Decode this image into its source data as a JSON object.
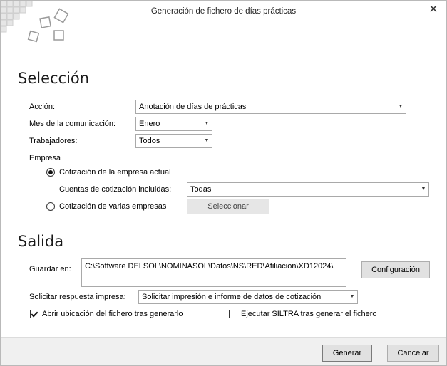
{
  "window": {
    "title": "Generación de fichero de días prácticas",
    "close_glyph": "✕"
  },
  "seleccion": {
    "title": "Selección",
    "accion_label": "Acción:",
    "accion_value": "Anotación de días de prácticas",
    "mes_label": "Mes de la comunicación:",
    "mes_value": "Enero",
    "trabajadores_label": "Trabajadores:",
    "trabajadores_value": "Todos",
    "empresa_label": "Empresa",
    "radio_actual_label": "Cotización de la empresa actual",
    "radio_actual_checked": true,
    "cuentas_label": "Cuentas de cotización incluidas:",
    "cuentas_value": "Todas",
    "radio_varias_label": "Cotización de varias empresas",
    "radio_varias_checked": false,
    "seleccionar_button": "Seleccionar"
  },
  "salida": {
    "title": "Salida",
    "guardar_label": "Guardar en:",
    "guardar_value": "C:\\Software DELSOL\\NOMINASOL\\Datos\\NS\\RED\\Afiliacion\\XD12024\\",
    "configuracion_button": "Configuración",
    "solicitar_label": "Solicitar respuesta impresa:",
    "solicitar_value": "Solicitar impresión e informe de datos de cotización",
    "abrir_label": "Abrir ubicación del fichero tras generarlo",
    "abrir_checked": true,
    "siltra_label": "Ejecutar SILTRA tras generar el fichero",
    "siltra_checked": false
  },
  "footer": {
    "generar_button": "Generar",
    "cancelar_button": "Cancelar"
  },
  "icons": {
    "dropdown": "▼"
  }
}
